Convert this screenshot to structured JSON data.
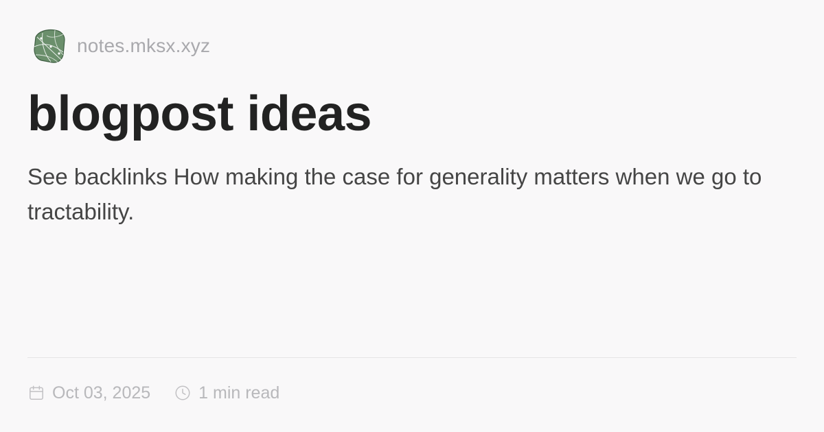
{
  "site": {
    "name": "notes.mksx.xyz",
    "logo_icon": "leaf-map-logo-icon",
    "logo_color": "#6b8f6c"
  },
  "post": {
    "title": "blogpost ideas",
    "description": "See backlinks How making the case for generality matters when we go to tractability."
  },
  "meta": {
    "date": "Oct 03, 2025",
    "date_icon": "calendar-icon",
    "read_time": "1 min read",
    "read_time_icon": "clock-icon"
  },
  "colors": {
    "background": "#f9f8f9",
    "title": "#222222",
    "body_text": "#454545",
    "muted": "#b8b8bb"
  }
}
